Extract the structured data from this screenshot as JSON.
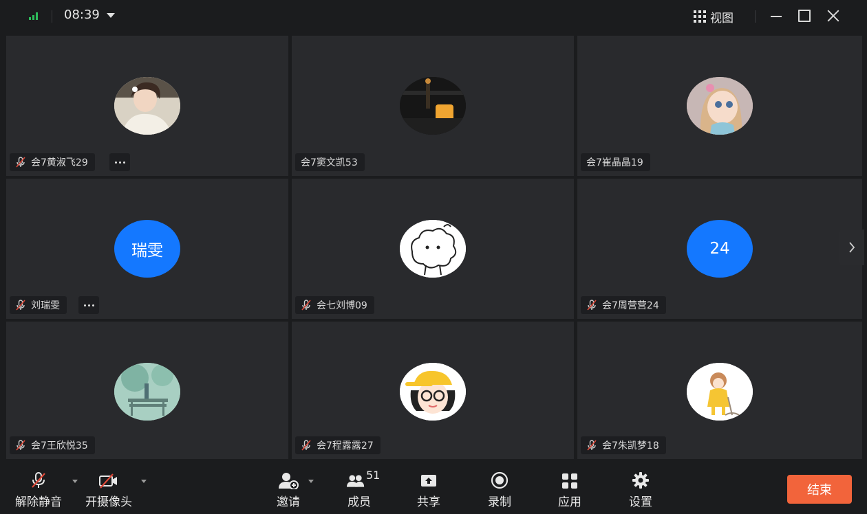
{
  "titlebar": {
    "time": "08:39",
    "view_label": "视图"
  },
  "participants": [
    {
      "name": "会7黄淑飞29",
      "muted": true,
      "more": true,
      "avatar": "photo-girl-icon"
    },
    {
      "name": "会7窦文凯53",
      "muted": false,
      "more": false,
      "avatar": "photo-night-lamp-icon"
    },
    {
      "name": "会7崔晶晶19",
      "muted": false,
      "more": false,
      "avatar": "cartoon-girl-icon"
    },
    {
      "name": "刘瑞雯",
      "muted": true,
      "more": true,
      "avatar_text": "瑞雯"
    },
    {
      "name": "会七刘博09",
      "muted": true,
      "more": false,
      "avatar": "sheep-sketch-icon"
    },
    {
      "name": "会7周营营24",
      "muted": true,
      "more": false,
      "avatar_text": "24"
    },
    {
      "name": "会7王欣悦35",
      "muted": true,
      "more": false,
      "avatar": "bench-landscape-icon"
    },
    {
      "name": "会7程露露27",
      "muted": true,
      "more": false,
      "avatar": "glasses-kid-icon"
    },
    {
      "name": "会7朱凯梦18",
      "muted": true,
      "more": false,
      "avatar": "raincoat-girl-icon"
    }
  ],
  "toolbar": {
    "unmute": "解除静音",
    "camera": "开摄像头",
    "invite": "邀请",
    "members": "成员",
    "members_count": "51",
    "share": "共享",
    "record": "录制",
    "apps": "应用",
    "settings": "设置",
    "end": "结束"
  },
  "colors": {
    "accent_blue": "#1478ff",
    "end_button": "#f2643b",
    "signal_green": "#2dbd5b",
    "mic_off_red": "#e04a3a"
  }
}
